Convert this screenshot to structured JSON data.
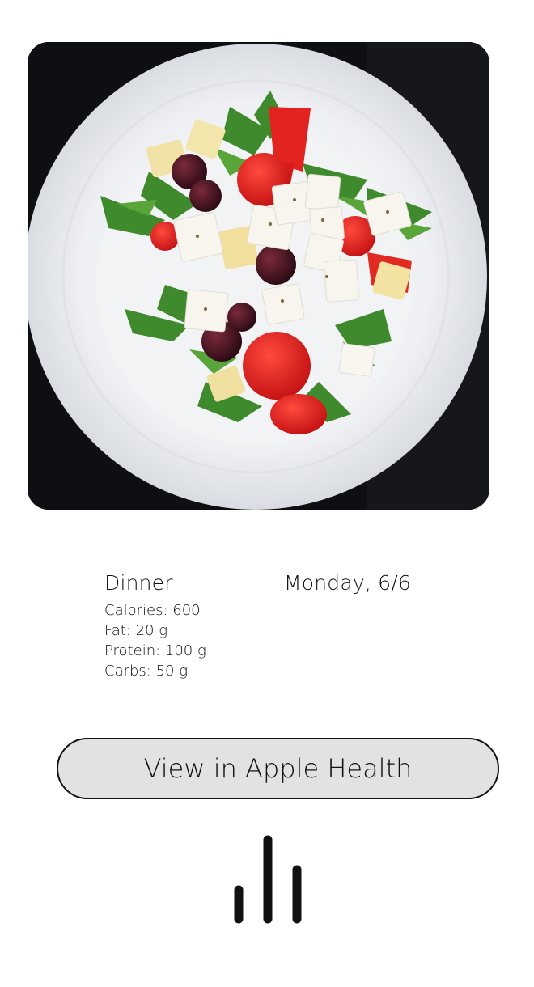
{
  "photo": {
    "icon": "salad-plate-photo"
  },
  "meal": {
    "name": "Dinner",
    "date": "Monday, 6/6",
    "calories": "Calories: 600",
    "fat": "Fat: 20 g",
    "protein": "Protein: 100 g",
    "carbs": "Carbs: 50 g"
  },
  "actions": {
    "health_button_label": "View in Apple Health"
  },
  "bottom_icon": {
    "icon": "audio-bars-icon"
  }
}
